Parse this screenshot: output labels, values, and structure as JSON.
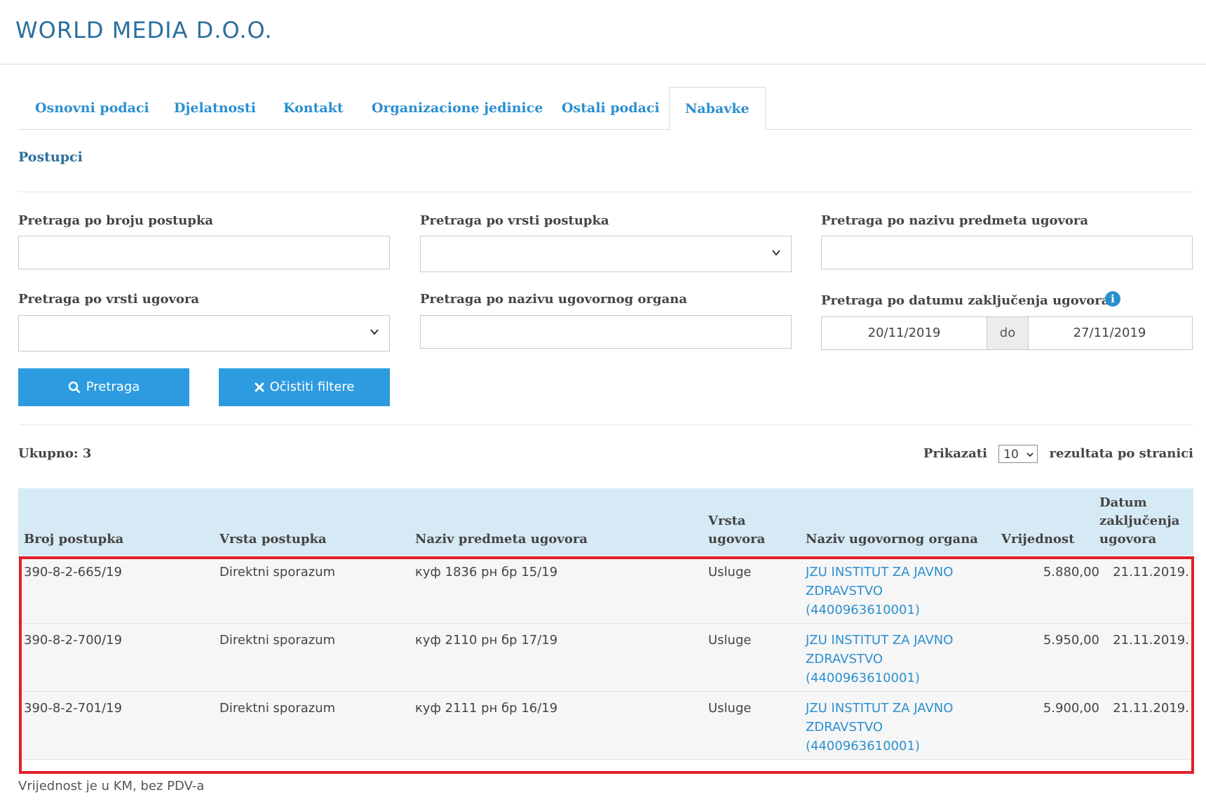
{
  "header": {
    "company": "WORLD MEDIA D.O.O."
  },
  "tabs": [
    {
      "label": "Osnovni podaci"
    },
    {
      "label": "Djelatnosti"
    },
    {
      "label": "Kontakt"
    },
    {
      "label": "Organizacione jedinice"
    },
    {
      "label": "Ostali podaci"
    },
    {
      "label": "Nabavke",
      "active": true
    }
  ],
  "section": {
    "title": "Postupci"
  },
  "filters": {
    "broj_postupka_label": "Pretraga po broju postupka",
    "broj_postupka_value": "",
    "vrsta_postupka_label": "Pretraga po vrsti postupka",
    "vrsta_postupka_value": "",
    "naziv_predmeta_label": "Pretraga po nazivu predmeta ugovora",
    "naziv_predmeta_value": "",
    "vrsta_ugovora_label": "Pretraga po vrsti ugovora",
    "vrsta_ugovora_value": "",
    "naziv_organa_label": "Pretraga po nazivu ugovornog organa",
    "naziv_organa_value": "",
    "datum_label": "Pretraga po datumu zaključenja ugovora",
    "datum_od": "20/11/2019",
    "datum_sep": "do",
    "datum_do": "27/11/2019"
  },
  "buttons": {
    "search": "Pretraga",
    "clear": "Očistiti filtere"
  },
  "results": {
    "total": "Ukupno: 3",
    "show_label": "Prikazati",
    "per_page": "10",
    "per_page_suffix": "rezultata po stranici"
  },
  "table": {
    "headers": {
      "broj": "Broj postupka",
      "vrsta": "Vrsta postupka",
      "naziv": "Naziv predmeta ugovora",
      "vrsta_ugovora_1": "Vrsta",
      "vrsta_ugovora_2": "ugovora",
      "organ": "Naziv ugovornog organa",
      "vrijednost": "Vrijednost",
      "datum_1": "Datum",
      "datum_2": "zaključenja",
      "datum_3": "ugovora"
    },
    "rows": [
      {
        "broj": "390-8-2-665/19",
        "vrsta": "Direktni sporazum",
        "naziv": "куф 1836 рн бр 15/19",
        "vrsta_ugovora": "Usluge",
        "organ_1": "JZU INSTITUT ZA JAVNO",
        "organ_2": "ZDRAVSTVO",
        "organ_3": "(4400963610001)",
        "vrijednost": "5.880,00",
        "datum": "21.11.2019."
      },
      {
        "broj": "390-8-2-700/19",
        "vrsta": "Direktni sporazum",
        "naziv": "куф 2110 рн бр 17/19",
        "vrsta_ugovora": "Usluge",
        "organ_1": "JZU INSTITUT ZA JAVNO",
        "organ_2": "ZDRAVSTVO",
        "organ_3": "(4400963610001)",
        "vrijednost": "5.950,00",
        "datum": "21.11.2019."
      },
      {
        "broj": "390-8-2-701/19",
        "vrsta": "Direktni sporazum",
        "naziv": "куф 2111 рн бр 16/19",
        "vrsta_ugovora": "Usluge",
        "organ_1": "JZU INSTITUT ZA JAVNO",
        "organ_2": "ZDRAVSTVO",
        "organ_3": "(4400963610001)",
        "vrijednost": "5.900,00",
        "datum": "21.11.2019."
      }
    ]
  },
  "footnote": "Vrijednost je u KM, bez PDV-a",
  "colors": {
    "accent": "#2b8fce",
    "button": "#2d9be0",
    "highlight": "#e01f2a",
    "table_header": "#d6eaf5"
  }
}
